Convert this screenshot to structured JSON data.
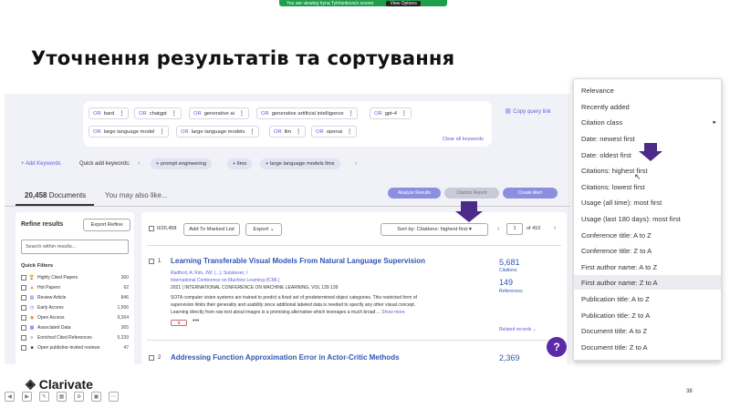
{
  "share_banner": {
    "text": "You are viewing Iryna Tykhonkova's screen",
    "button": "View Options"
  },
  "slide": {
    "title": "Уточнення результатів та сортування",
    "page_number": "38",
    "logo": "Clarivate"
  },
  "keywords": [
    {
      "or": "OR",
      "term": "bard"
    },
    {
      "or": "OR",
      "term": "chatgpt"
    },
    {
      "or": "OR",
      "term": "generative ai"
    },
    {
      "or": "OR",
      "term": "generative artificial intelligence"
    },
    {
      "or": "OR",
      "term": "gpt-4"
    },
    {
      "or": "OR",
      "term": "large language model"
    },
    {
      "or": "OR",
      "term": "large language models"
    },
    {
      "or": "OR",
      "term": "llm"
    },
    {
      "or": "OR",
      "term": "openai"
    }
  ],
  "copy_query_link": "Copy query link",
  "clear_keywords": "Clear all keywords",
  "add_keywords": "+ Add Keywords",
  "quick_add_label": "Quick add keywords:",
  "quick_keywords": [
    "+ prompt engineering",
    "+ llms",
    "+ large language models llms"
  ],
  "tabs": {
    "count": "20,458",
    "documents": "Documents",
    "maybe": "You may also like..."
  },
  "actions": {
    "analyze": "Analyze Results",
    "citation_report": "Citation Report",
    "create_alert": "Create Alert"
  },
  "refine": {
    "title": "Refine results",
    "export": "Export Refine",
    "search_placeholder": "Search within results...",
    "quick_filters": "Quick Filters"
  },
  "filters": [
    {
      "label": "Highly Cited Papers",
      "count": "360",
      "icon": "trophy-icon",
      "color": "#c0392b"
    },
    {
      "label": "Hot Papers",
      "count": "62",
      "icon": "flame-icon",
      "color": "#e67e22"
    },
    {
      "label": "Review Article",
      "count": "846",
      "icon": "document-icon",
      "color": "#5b5fd8"
    },
    {
      "label": "Early Access",
      "count": "1,566",
      "icon": "clock-icon",
      "color": "#5b5fd8"
    },
    {
      "label": "Open Access",
      "count": "9,264",
      "icon": "unlock-icon",
      "color": "#e67e22"
    },
    {
      "label": "Associated Data",
      "count": "365",
      "icon": "database-icon",
      "color": "#5b5fd8"
    },
    {
      "label": "Enriched Cited References",
      "count": "5,239",
      "icon": "list-icon",
      "color": "#5b5fd8"
    },
    {
      "label": "Open publisher-invited reviews",
      "count": "47",
      "icon": "review-icon",
      "color": "#333"
    }
  ],
  "results_toolbar": {
    "selected": "0/20,458",
    "add_marked": "Add To Marked List",
    "export": "Export",
    "sort": "Sort by: Citations: highest first",
    "page": "1",
    "of": "of 410"
  },
  "results": [
    {
      "num": "1",
      "title": "Learning Transferable Visual Models From Natural Language Supervision",
      "authors": "Radford, A; Kim, JW; (...); Sutskever, I",
      "venue": "International Conference on Machine Learning (ICML)",
      "meta": "2021 | INTERNATIONAL CONFERENCE ON MACHINE LEARNING, VOL 139 139",
      "abstract1": "SOTA computer vision systems are trained to predict a fixed set of predetermined object categories. This restricted form of",
      "abstract2": "supervision limits their generality and usability since additional labeled data is needed to specify any other visual concept.",
      "abstract3": "Learning directly from raw text about images is a promising alternative which leverages a much broad ...",
      "show_more": "Show more",
      "citations": "5,681",
      "citations_label": "Citations",
      "refs": "149",
      "refs_label": "References",
      "related": "Related records"
    },
    {
      "num": "2",
      "title": "Addressing Function Approximation Error in Actor-Critic Methods",
      "citations": "2,369"
    }
  ],
  "sort_menu": [
    "Relevance",
    "Recently added",
    "Citation class",
    "Date: newest first",
    "Date: oldest first",
    "Citations: highest first",
    "Citations: lowest first",
    "Usage (all time): most first",
    "Usage (last 180 days): most first",
    "Conference title: A to Z",
    "Conference title: Z to A",
    "First author name: A to Z",
    "First author name: Z to A",
    "Publication title: A to Z",
    "Publication title: Z to A",
    "Document title: A to Z",
    "Document title: Z to A"
  ],
  "colors": {
    "accent": "#5b5fd8",
    "pill": "#8c8fe0",
    "arrow": "#4b2a8a"
  }
}
